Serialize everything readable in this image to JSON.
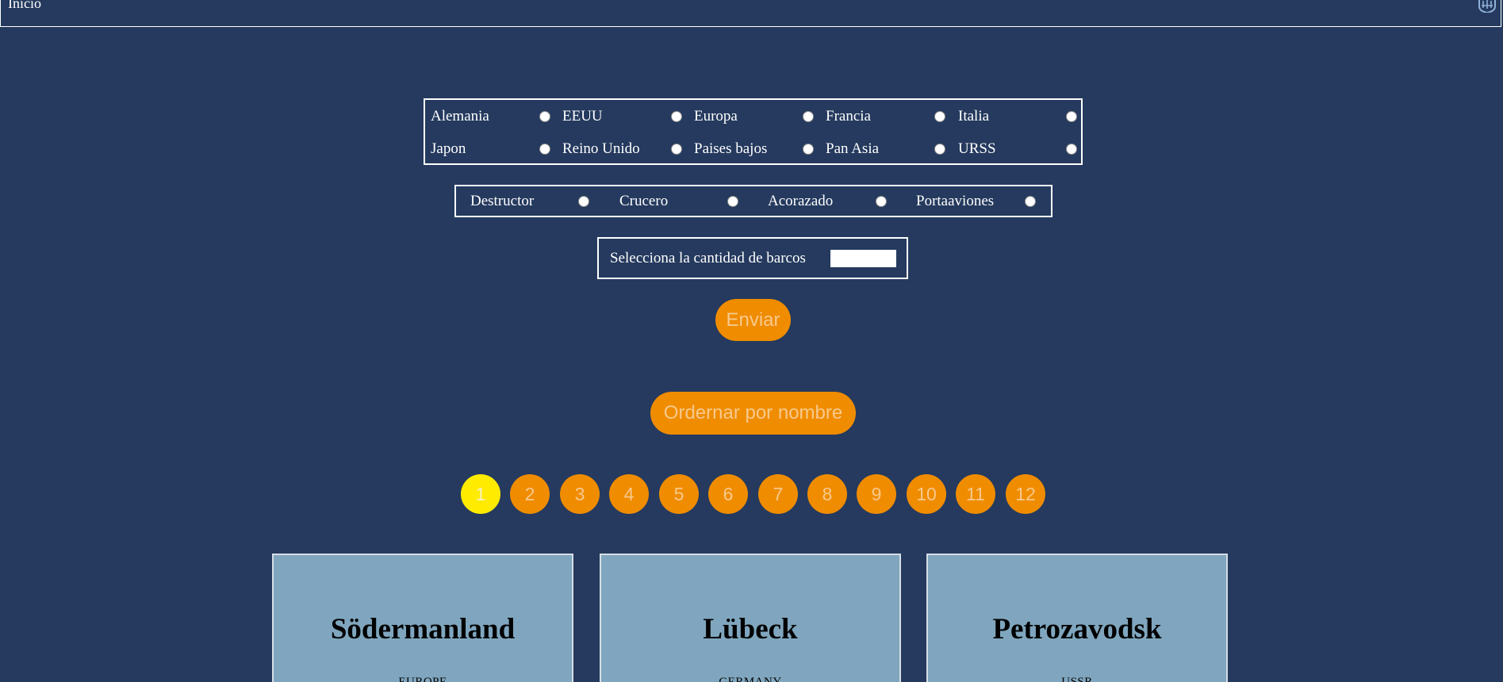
{
  "header": {
    "home_label": "Inicio",
    "logo_icon": "ship-crest-icon"
  },
  "nations": [
    {
      "label": "Alemania"
    },
    {
      "label": "EEUU"
    },
    {
      "label": "Europa"
    },
    {
      "label": "Francia"
    },
    {
      "label": "Italia"
    },
    {
      "label": "Japon"
    },
    {
      "label": "Reino Unido"
    },
    {
      "label": "Paises bajos"
    },
    {
      "label": "Pan Asia"
    },
    {
      "label": "URSS"
    }
  ],
  "ship_types": [
    {
      "label": "Destructor"
    },
    {
      "label": "Crucero"
    },
    {
      "label": "Acorazado"
    },
    {
      "label": "Portaaviones"
    }
  ],
  "quantity": {
    "label": "Selecciona la cantidad de barcos",
    "value": ""
  },
  "actions": {
    "send_label": "Enviar",
    "sort_label": "Ordernar por nombre"
  },
  "pagination": {
    "current": 1,
    "pages": [
      "1",
      "2",
      "3",
      "4",
      "5",
      "6",
      "7",
      "8",
      "9",
      "10",
      "11",
      "12"
    ]
  },
  "cards": [
    {
      "name": "Södermanland",
      "nation": "EUROPE"
    },
    {
      "name": "Lübeck",
      "nation": "GERMANY"
    },
    {
      "name": "Petrozavodsk",
      "nation": "USSR"
    }
  ],
  "colors": {
    "background": "#253a5e",
    "accent": "#f08c00",
    "active_page": "#ffeb00",
    "card": "#7fa6be"
  }
}
